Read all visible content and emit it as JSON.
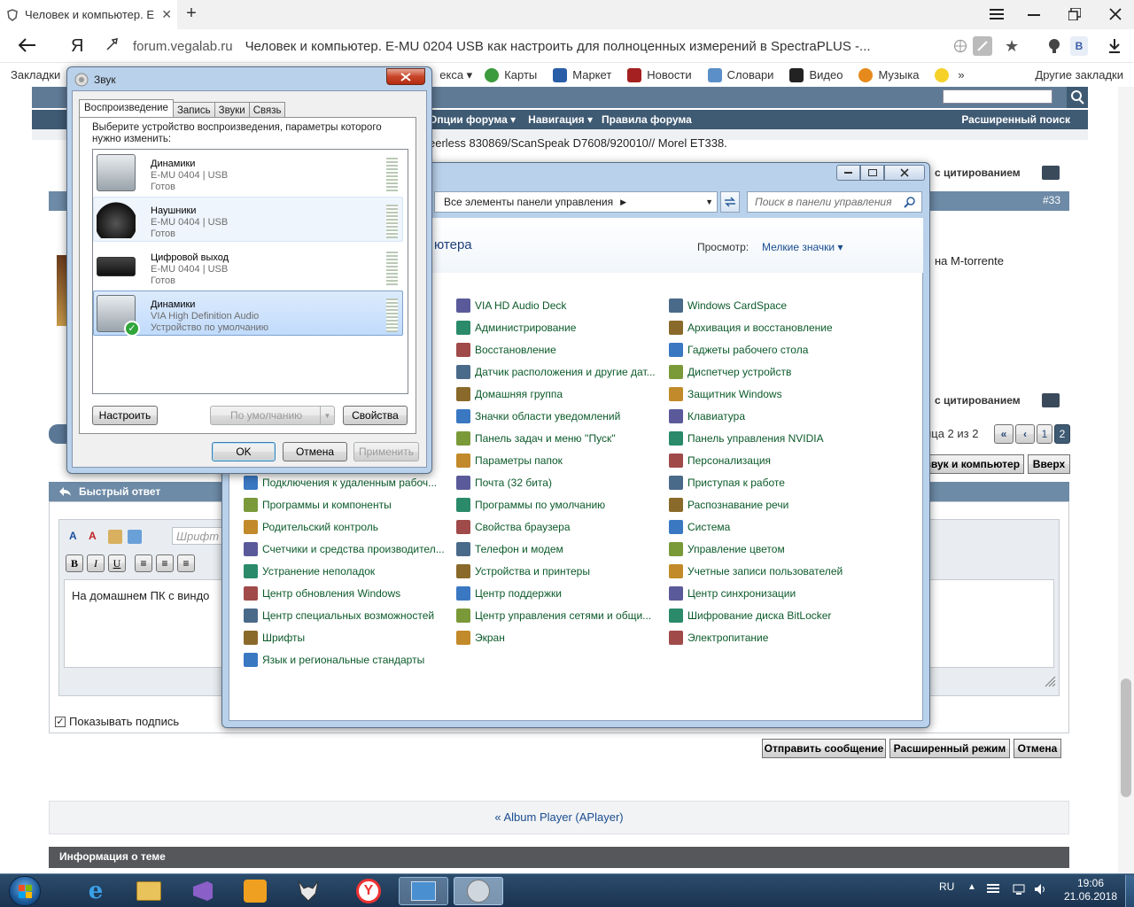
{
  "browser": {
    "tab_title": "Человек и компьютер. E",
    "new_tab": "+",
    "url_domain": "forum.vegalab.ru",
    "url_title": "Человек и компьютер. E-MU 0204 USB как настроить для полноценных измерений в SpectraPLUS -...",
    "yandex_logo": "Я",
    "bookmarks": [
      "Закладки",
      "Карты",
      "Маркет",
      "Новости",
      "Словари",
      "Видео",
      "Музыка"
    ],
    "bookmark_partial": "екса ▾",
    "other_bookmarks": "Другие закладки",
    "more": "»"
  },
  "forum": {
    "nav": [
      "Опции форума ▾",
      "Навигация ▾",
      "Правила форума"
    ],
    "adv_search": "Расширенный поиск",
    "post_text_1": "eerless 830869/ScanSpeak D7608/920010// Morel ET338.",
    "reply_quote": "с цитированием",
    "post_number": "#33",
    "post_text_2": "на M-torrente",
    "pager_label": "ица 2 из 2",
    "pages": [
      "«",
      "‹",
      "1",
      "2"
    ],
    "section_btn": "звук и компьютер",
    "top_btn": "Вверх",
    "quick_reply": "Быстрый ответ",
    "font_placeholder": "Шрифт",
    "editor_text": "На домашнем ПК с виндо",
    "show_signature": "Показывать подпись",
    "send": "Отправить сообщение",
    "advanced_mode": "Расширенный режим",
    "cancel": "Отмена",
    "prev_thread": "« Album Player (APlayer)",
    "thread_info": "Информация о теме"
  },
  "taskbar": {
    "lang": "RU",
    "time": "19:06",
    "date": "21.06.2018"
  },
  "control_panel": {
    "breadcrumb": "Все элементы панели управления",
    "search_placeholder": "Поиск в панели управления",
    "heading": "ютера",
    "view_label": "Просмотр:",
    "view_value": "Мелкие значки ▾",
    "columns": [
      [
        "",
        "",
        "",
        "",
        "",
        "",
        "",
        "",
        "Подключения к удаленным рабоч...",
        "Программы и компоненты",
        "Родительский контроль",
        "Счетчики и средства производител...",
        "Устранение неполадок",
        "Центр обновления Windows",
        "Центр специальных возможностей",
        "Шрифты",
        "Язык и региональные стандарты"
      ],
      [
        "VIA HD Audio Deck",
        "Администрирование",
        "Восстановление",
        "Датчик расположения и другие дат...",
        "Домашняя группа",
        "Значки области уведомлений",
        "Панель задач и меню ''Пуск''",
        "Параметры папок",
        "Почта (32 бита)",
        "Программы по умолчанию",
        "Свойства браузера",
        "Телефон и модем",
        "Устройства и принтеры",
        "Центр поддержки",
        "Центр управления сетями и общи...",
        "Экран"
      ],
      [
        "Windows CardSpace",
        "Архивация и восстановление",
        "Гаджеты рабочего стола",
        "Диспетчер устройств",
        "Защитник Windows",
        "Клавиатура",
        "Панель управления NVIDIA",
        "Персонализация",
        "Приступая к работе",
        "Распознавание речи",
        "Система",
        "Управление цветом",
        "Учетные записи пользователей",
        "Центр синхронизации",
        "Шифрование диска BitLocker",
        "Электропитание"
      ]
    ]
  },
  "sound": {
    "title": "Звук",
    "tabs": [
      "Воспроизведение",
      "Запись",
      "Звуки",
      "Связь"
    ],
    "instruction": "Выберите устройство воспроизведения, параметры которого нужно изменить:",
    "devices": [
      {
        "name": "Динамики",
        "sub": "E-MU 0404 | USB",
        "status": "Готов"
      },
      {
        "name": "Наушники",
        "sub": "E-MU 0404 | USB",
        "status": "Готов"
      },
      {
        "name": "Цифровой выход",
        "sub": "E-MU 0404 | USB",
        "status": "Готов"
      },
      {
        "name": "Динамики",
        "sub": "VIA High Definition Audio",
        "status": "Устройство по умолчанию"
      }
    ],
    "configure": "Настроить",
    "default": "По умолчанию",
    "properties": "Свойства",
    "ok": "OK",
    "cancel": "Отмена",
    "apply": "Применить"
  },
  "colors": {
    "forum_nav": "#3f5a73",
    "cp_link": "#0b5a2a",
    "selection": "#cde4f7"
  }
}
